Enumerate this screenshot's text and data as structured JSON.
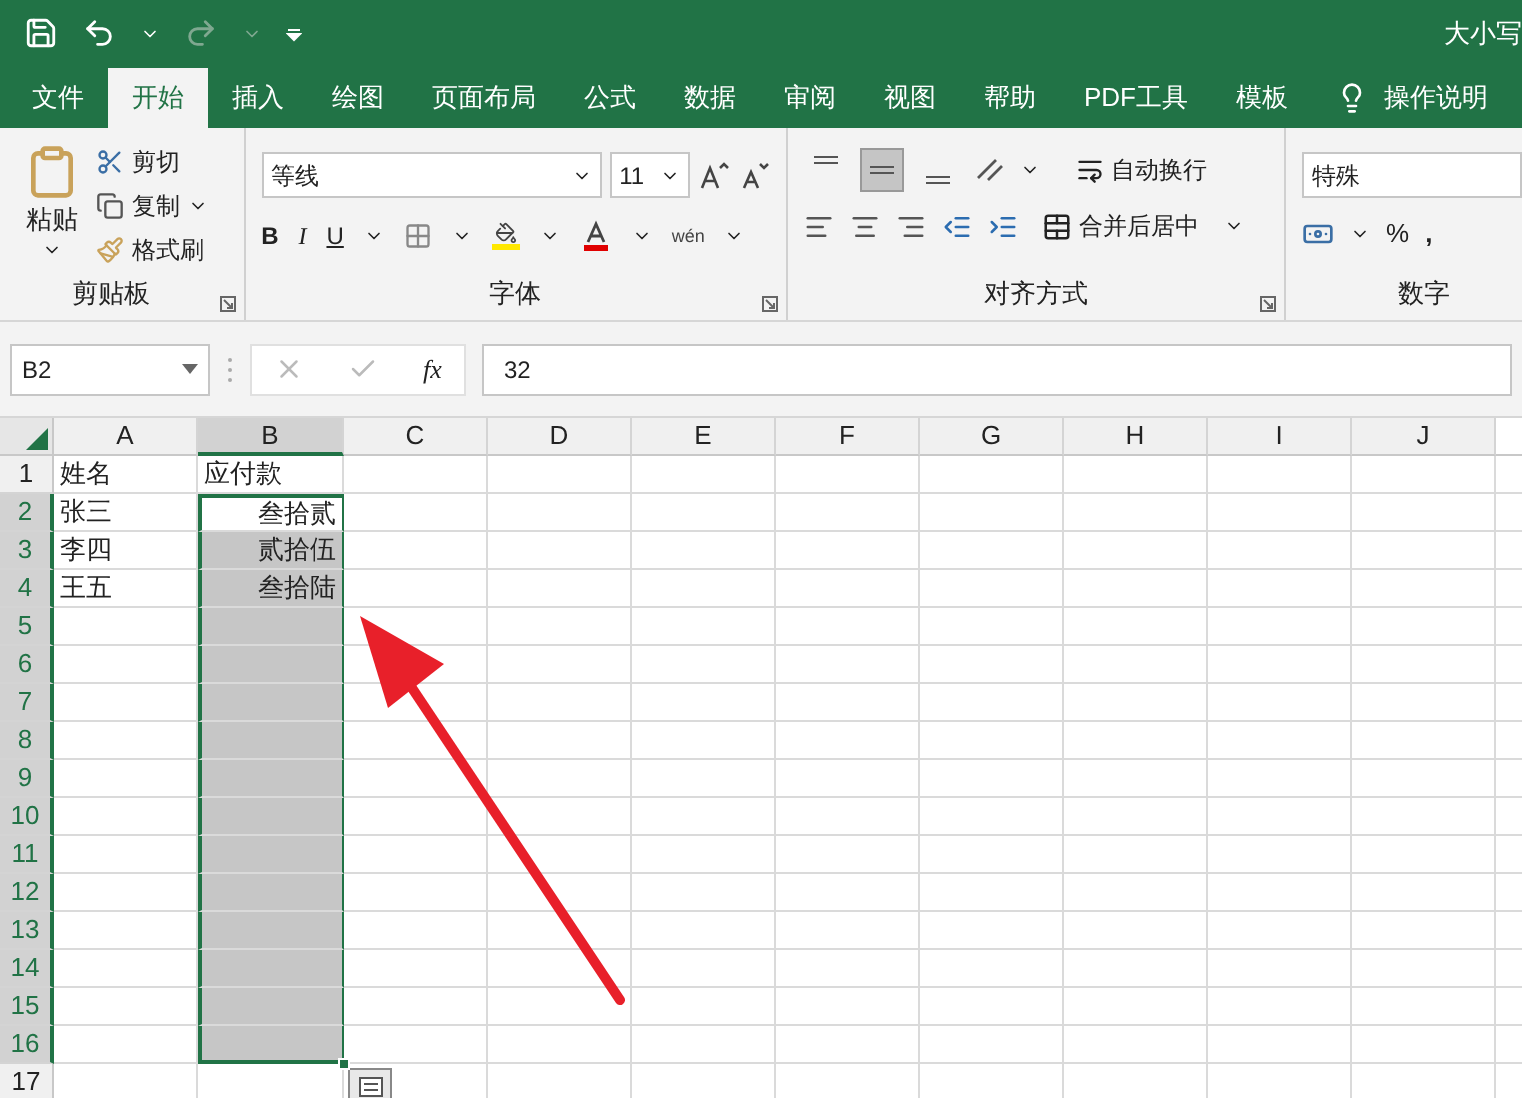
{
  "window": {
    "title": "大小写"
  },
  "tabs": [
    {
      "label": "文件",
      "selected": false
    },
    {
      "label": "开始",
      "selected": true
    },
    {
      "label": "插入",
      "selected": false
    },
    {
      "label": "绘图",
      "selected": false
    },
    {
      "label": "页面布局",
      "selected": false
    },
    {
      "label": "公式",
      "selected": false
    },
    {
      "label": "数据",
      "selected": false
    },
    {
      "label": "审阅",
      "selected": false
    },
    {
      "label": "视图",
      "selected": false
    },
    {
      "label": "帮助",
      "selected": false
    },
    {
      "label": "PDF工具",
      "selected": false
    },
    {
      "label": "模板",
      "selected": false
    }
  ],
  "tell_me": "操作说明",
  "clipboard": {
    "paste": "粘贴",
    "cut": "剪切",
    "copy": "复制",
    "format_painter": "格式刷",
    "label": "剪贴板"
  },
  "font": {
    "name": "等线",
    "size": "11",
    "bold": "B",
    "italic": "I",
    "underline": "U",
    "phonetic": "wén",
    "label": "字体"
  },
  "alignment": {
    "vertical": [
      {
        "selected": false
      },
      {
        "selected": true
      },
      {
        "selected": false
      }
    ],
    "wrap": "自动换行",
    "merge": "合并后居中",
    "label": "对齐方式"
  },
  "number": {
    "format": "特殊",
    "percent": "%",
    "comma": ",",
    "label": "数字"
  },
  "formula_bar": {
    "name_box": "B2",
    "fx": "fx",
    "value": "32"
  },
  "columns": [
    {
      "label": "A",
      "selected": false
    },
    {
      "label": "B",
      "selected": true
    },
    {
      "label": "C",
      "selected": false
    },
    {
      "label": "D",
      "selected": false
    },
    {
      "label": "E",
      "selected": false
    },
    {
      "label": "F",
      "selected": false
    },
    {
      "label": "G",
      "selected": false
    },
    {
      "label": "H",
      "selected": false
    },
    {
      "label": "I",
      "selected": false
    },
    {
      "label": "J",
      "selected": false
    }
  ],
  "rows": [
    {
      "number": "1",
      "selected": false,
      "cells": [
        {
          "text": "姓名",
          "selected": false,
          "active": false
        },
        {
          "text": "应付款",
          "selected": false,
          "active": false
        }
      ]
    },
    {
      "number": "2",
      "selected": true,
      "cells": [
        {
          "text": "张三",
          "selected": false,
          "active": false
        },
        {
          "text": "叁拾贰",
          "selected": true,
          "active": true
        }
      ]
    },
    {
      "number": "3",
      "selected": true,
      "cells": [
        {
          "text": "李四",
          "selected": false,
          "active": false
        },
        {
          "text": "贰拾伍",
          "selected": true,
          "active": false
        }
      ]
    },
    {
      "number": "4",
      "selected": true,
      "cells": [
        {
          "text": "王五",
          "selected": false,
          "active": false
        },
        {
          "text": "叁拾陆",
          "selected": true,
          "active": false
        }
      ]
    },
    {
      "number": "5",
      "selected": true,
      "cells": [
        {
          "selected": false,
          "active": false
        },
        {
          "selected": true,
          "active": false
        }
      ]
    },
    {
      "number": "6",
      "selected": true,
      "cells": [
        {
          "selected": false,
          "active": false
        },
        {
          "selected": true,
          "active": false
        }
      ]
    },
    {
      "number": "7",
      "selected": true,
      "cells": [
        {
          "selected": false,
          "active": false
        },
        {
          "selected": true,
          "active": false
        }
      ]
    },
    {
      "number": "8",
      "selected": true,
      "cells": [
        {
          "selected": false,
          "active": false
        },
        {
          "selected": true,
          "active": false
        }
      ]
    },
    {
      "number": "9",
      "selected": true,
      "cells": [
        {
          "selected": false,
          "active": false
        },
        {
          "selected": true,
          "active": false
        }
      ]
    },
    {
      "number": "10",
      "selected": true,
      "cells": [
        {
          "selected": false,
          "active": false
        },
        {
          "selected": true,
          "active": false
        }
      ]
    },
    {
      "number": "11",
      "selected": true,
      "cells": [
        {
          "selected": false,
          "active": false
        },
        {
          "selected": true,
          "active": false
        }
      ]
    },
    {
      "number": "12",
      "selected": true,
      "cells": [
        {
          "selected": false,
          "active": false
        },
        {
          "selected": true,
          "active": false
        }
      ]
    },
    {
      "number": "13",
      "selected": true,
      "cells": [
        {
          "selected": false,
          "active": false
        },
        {
          "selected": true,
          "active": false
        }
      ]
    },
    {
      "number": "14",
      "selected": true,
      "cells": [
        {
          "selected": false,
          "active": false
        },
        {
          "selected": true,
          "active": false
        }
      ]
    },
    {
      "number": "15",
      "selected": true,
      "cells": [
        {
          "selected": false,
          "active": false
        },
        {
          "selected": true,
          "active": false
        }
      ]
    },
    {
      "number": "16",
      "selected": true,
      "cells": [
        {
          "selected": false,
          "active": false
        },
        {
          "selected": true,
          "active": false
        }
      ]
    },
    {
      "number": "17",
      "selected": false,
      "cells": [
        {
          "selected": false,
          "active": false
        },
        {
          "selected": false,
          "active": false
        }
      ]
    }
  ]
}
